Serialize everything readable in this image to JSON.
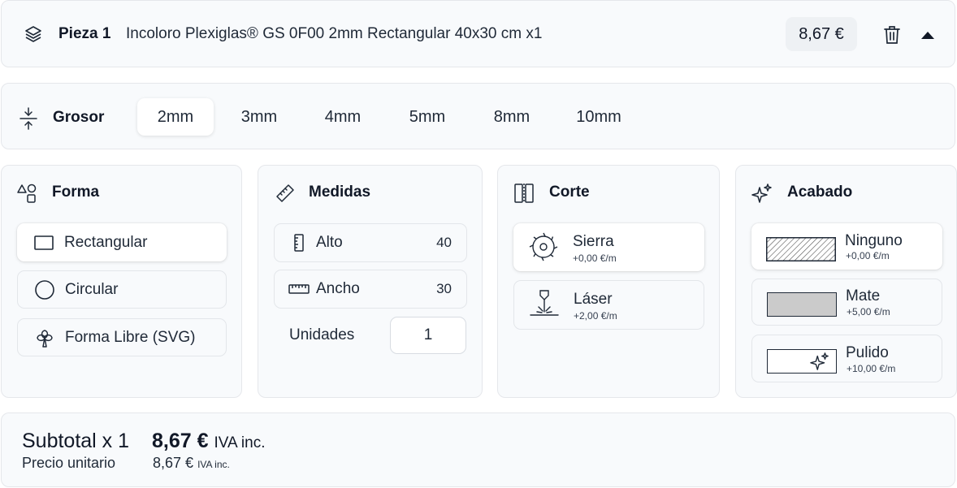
{
  "header": {
    "piece_label": "Pieza 1",
    "piece_description": "Incoloro Plexiglas® GS 0F00 2mm Rectangular 40x30 cm x1",
    "price": "8,67 €",
    "icons": [
      "stack-icon",
      "trash-icon",
      "collapse-icon"
    ]
  },
  "thickness": {
    "label": "Grosor",
    "options": [
      "2mm",
      "3mm",
      "4mm",
      "5mm",
      "8mm",
      "10mm"
    ],
    "selected": "2mm"
  },
  "shape": {
    "title": "Forma",
    "options": [
      {
        "label": "Rectangular",
        "icon": "rectangle-icon"
      },
      {
        "label": "Circular",
        "icon": "circle-icon"
      },
      {
        "label": "Forma Libre (SVG)",
        "icon": "clover-icon"
      }
    ],
    "selected": "Rectangular"
  },
  "measures": {
    "title": "Medidas",
    "height_label": "Alto",
    "height_value": "40",
    "width_label": "Ancho",
    "width_value": "30",
    "units_label": "Unidades",
    "units_value": "1"
  },
  "cut": {
    "title": "Corte",
    "options": [
      {
        "name": "Sierra",
        "price": "+0,00 €/m",
        "icon": "saw-blade-icon"
      },
      {
        "name": "Láser",
        "price": "+2,00 €/m",
        "icon": "laser-icon"
      }
    ],
    "selected": "Sierra"
  },
  "finish": {
    "title": "Acabado",
    "options": [
      {
        "name": "Ninguno",
        "price": "+0,00 €/m",
        "swatch": "hatched"
      },
      {
        "name": "Mate",
        "price": "+5,00 €/m",
        "swatch": "#cbcbcb"
      },
      {
        "name": "Pulido",
        "price": "+10,00 €/m",
        "swatch": "sparkle"
      }
    ],
    "selected": "Ninguno"
  },
  "footer": {
    "subtotal_label": "Subtotal x 1",
    "subtotal_price": "8,67 €",
    "subtotal_tax": "IVA inc.",
    "unit_label": "Precio unitario",
    "unit_price": "8,67 €",
    "unit_tax": "IVA inc."
  },
  "colors": {
    "card_bg": "#f8fafc",
    "border": "#e5e7eb",
    "text": "#1f2937",
    "mate_swatch": "#cbcbcb"
  }
}
